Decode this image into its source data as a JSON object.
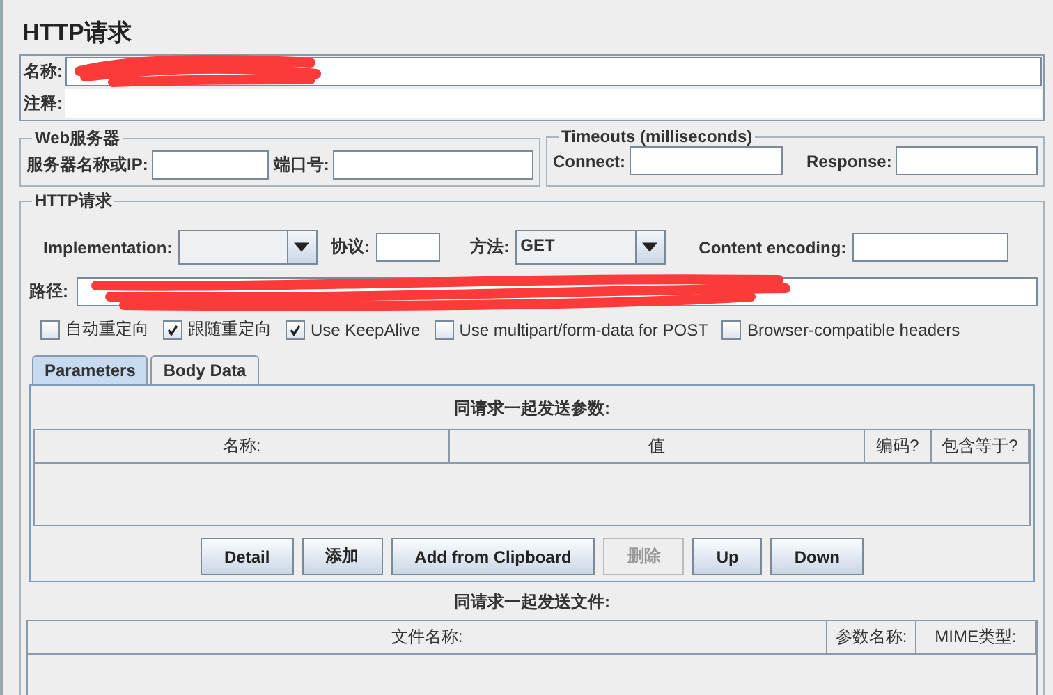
{
  "title": "HTTP请求",
  "name_field": {
    "label": "名称:"
  },
  "comment_field": {
    "label": "注释:"
  },
  "web_server": {
    "legend": "Web服务器",
    "server_label": "服务器名称或IP:",
    "port_label": "端口号:"
  },
  "timeouts": {
    "legend": "Timeouts (milliseconds)",
    "connect_label": "Connect:",
    "response_label": "Response:"
  },
  "http": {
    "legend": "HTTP请求",
    "implementation_label": "Implementation:",
    "protocol_label": "协议:",
    "method_label": "方法:",
    "method_value": "GET",
    "encoding_label": "Content encoding:",
    "path_label": "路径:",
    "options": [
      {
        "label": "自动重定向",
        "checked": false
      },
      {
        "label": "跟随重定向",
        "checked": true
      },
      {
        "label": "Use KeepAlive",
        "checked": true
      },
      {
        "label": "Use multipart/form-data for POST",
        "checked": false
      },
      {
        "label": "Browser-compatible headers",
        "checked": false
      }
    ],
    "tabs": [
      {
        "label": "Parameters",
        "selected": true
      },
      {
        "label": "Body Data",
        "selected": false
      }
    ],
    "params": {
      "caption": "同请求一起发送参数:",
      "columns": [
        "名称:",
        "值",
        "编码?",
        "包含等于?"
      ],
      "buttons": [
        {
          "label": "Detail",
          "disabled": false
        },
        {
          "label": "添加",
          "disabled": false
        },
        {
          "label": "Add from Clipboard",
          "disabled": false
        },
        {
          "label": "删除",
          "disabled": true
        },
        {
          "label": "Up",
          "disabled": false
        },
        {
          "label": "Down",
          "disabled": false
        }
      ]
    },
    "files": {
      "caption": "同请求一起发送文件:",
      "columns": [
        "文件名称:",
        "参数名称:",
        "MIME类型:"
      ]
    }
  }
}
